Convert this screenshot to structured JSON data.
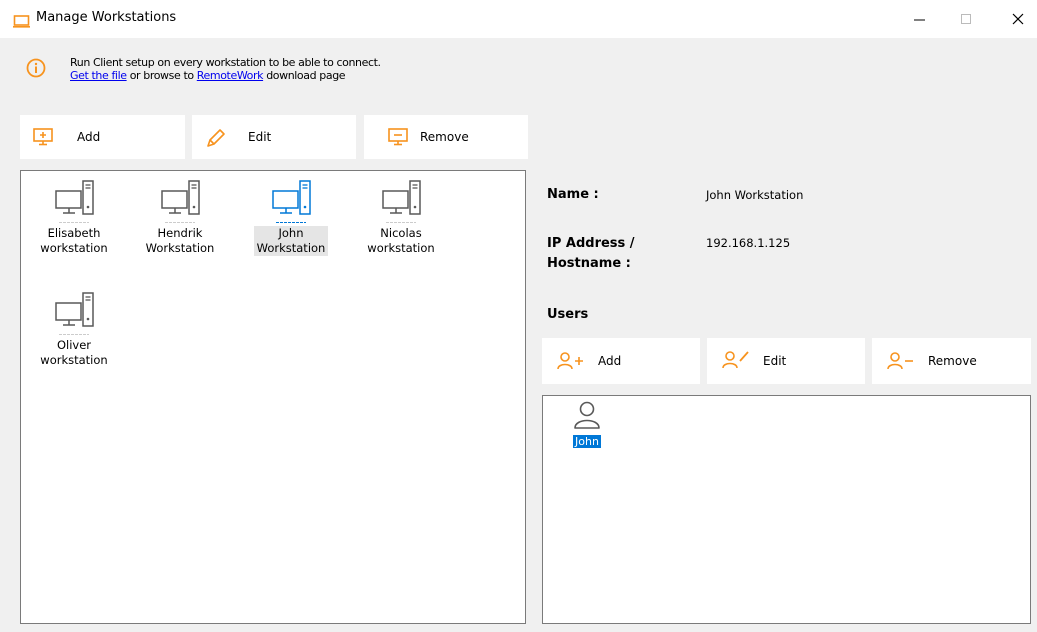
{
  "window": {
    "title": "Manage Workstations",
    "icons": {
      "app": "laptop-icon",
      "minimize": "minimize-icon",
      "maximize": "maximize-icon",
      "close": "close-icon"
    }
  },
  "info": {
    "icon": "info-icon",
    "line1": "Run Client setup on every workstation to be able to connect.",
    "link1": "Get the file",
    "mid_text": " or browse to ",
    "link2": "RemoteWork",
    "tail_text": " download page"
  },
  "toolbar": {
    "add_label": "Add",
    "edit_label": "Edit",
    "remove_label": "Remove"
  },
  "workstations": [
    {
      "line1": "Elisabeth",
      "line2": "workstation",
      "selected": false
    },
    {
      "line1": "Hendrik",
      "line2": "Workstation",
      "selected": false
    },
    {
      "line1": "John",
      "line2": "Workstation",
      "selected": true
    },
    {
      "line1": "Nicolas",
      "line2": "workstation",
      "selected": false
    },
    {
      "line1": "Oliver",
      "line2": "workstation",
      "selected": false
    }
  ],
  "details": {
    "name_label": "Name :",
    "name_value": "John Workstation",
    "ip_label_line1": "IP Address /",
    "ip_label_line2": "Hostname :",
    "ip_value": "192.168.1.125",
    "users_label": "Users"
  },
  "user_toolbar": {
    "add_label": "Add",
    "edit_label": "Edit",
    "remove_label": "Remove"
  },
  "users": [
    {
      "name": "John",
      "selected": true
    }
  ],
  "colors": {
    "accent_orange": "#f7931e",
    "selected_blue": "#0078d7",
    "icon_gray": "#595959",
    "link_blue": "#0000ee"
  }
}
